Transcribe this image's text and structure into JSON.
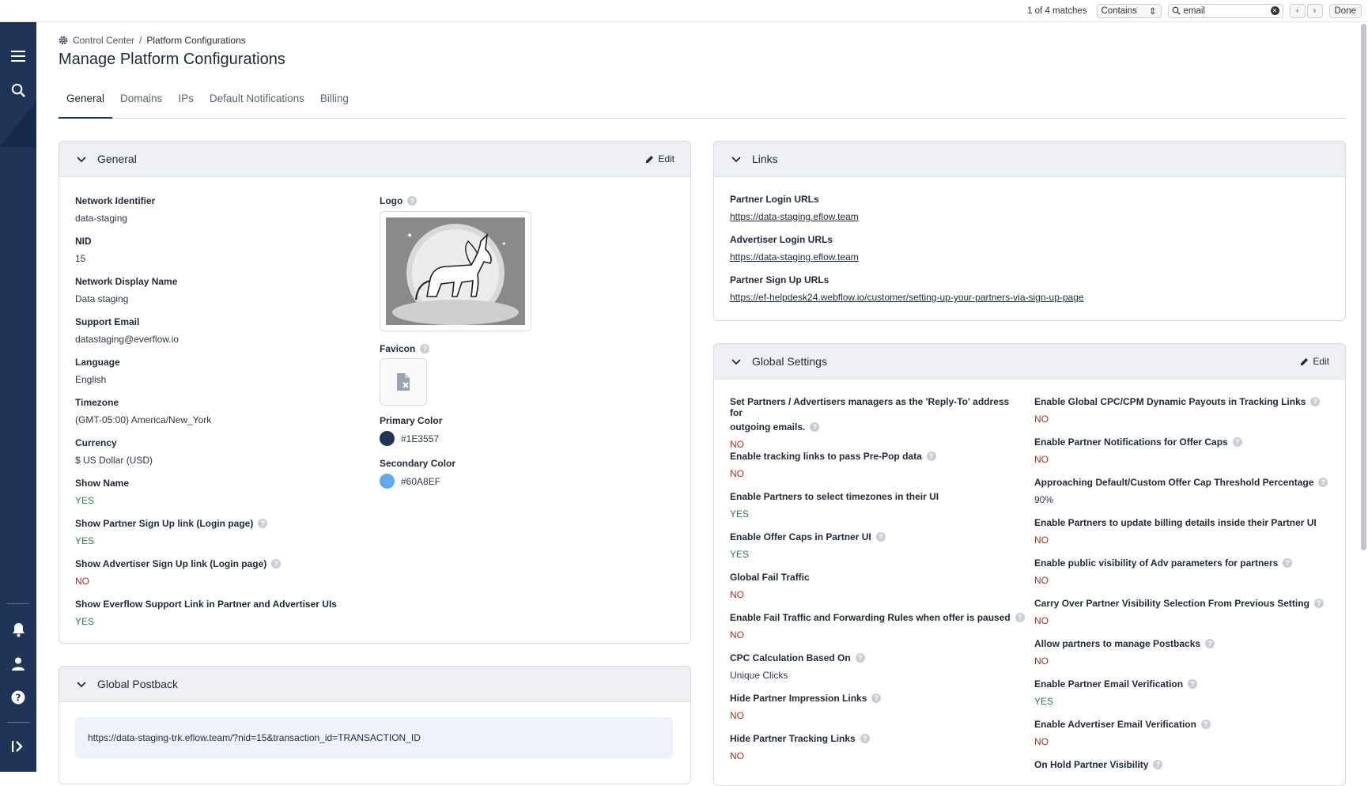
{
  "find_bar": {
    "matches": "1 of 4 matches",
    "mode": "Contains",
    "query": "email",
    "done": "Done"
  },
  "breadcrumb": {
    "root": "Control Center",
    "separator": "/",
    "current": "Platform Configurations"
  },
  "page_title": "Manage Platform Configurations",
  "tabs": [
    "General",
    "Domains",
    "IPs",
    "Default Notifications",
    "Billing"
  ],
  "general": {
    "title": "General",
    "edit": "Edit",
    "fields": [
      {
        "label": "Network Identifier",
        "value": "data-staging"
      },
      {
        "label": "NID",
        "value": "15"
      },
      {
        "label": "Network Display Name",
        "value": "Data staging"
      },
      {
        "label": "Support Email",
        "value": "datastaging@everflow.io"
      },
      {
        "label": "Language",
        "value": "English"
      },
      {
        "label": "Timezone",
        "value": "(GMT-05:00) America/New_York"
      },
      {
        "label": "Currency",
        "value": "$ US Dollar (USD)"
      },
      {
        "label": "Show Name",
        "value": "YES"
      },
      {
        "label": "Show Partner Sign Up link (Login page)",
        "value": "YES"
      },
      {
        "label": "Show Advertiser Sign Up link (Login page)",
        "value": "NO"
      },
      {
        "label": "Show Everflow Support Link in Partner and Advertiser UIs",
        "value": "YES"
      }
    ],
    "logo_label": "Logo",
    "favicon_label": "Favicon",
    "primary_color_label": "Primary Color",
    "primary_color": "#1E3557",
    "secondary_color_label": "Secondary Color",
    "secondary_color": "#60A8EF"
  },
  "links": {
    "title": "Links",
    "fields": [
      {
        "label": "Partner Login URLs",
        "value": "https://data-staging.eflow.team"
      },
      {
        "label": "Advertiser Login URLs",
        "value": "https://data-staging.eflow.team"
      },
      {
        "label": "Partner Sign Up URLs",
        "value": "https://ef-helpdesk24.webflow.io/customer/setting-up-your-partners-via-sign-up-page"
      }
    ]
  },
  "global_settings": {
    "title": "Global Settings",
    "edit": "Edit",
    "left": [
      {
        "label": "Set Partners / Advertisers managers as the 'Reply-To' address for",
        "label2": "outgoing emails.",
        "value": "NO"
      },
      {
        "label": "Enable tracking links to pass Pre-Pop data",
        "value": "NO"
      },
      {
        "label": "Enable Partners to select timezones in their UI",
        "value": "YES"
      },
      {
        "label": "Enable Offer Caps in Partner UI",
        "value": "YES"
      },
      {
        "label": "Global Fail Traffic",
        "value": "NO"
      },
      {
        "label": "Enable Fail Traffic and Forwarding Rules when offer is paused",
        "value": "NO"
      },
      {
        "label": "CPC Calculation Based On",
        "value": "Unique Clicks"
      },
      {
        "label": "Hide Partner Impression Links",
        "value": "NO"
      },
      {
        "label": "Hide Partner Tracking Links",
        "value": "NO"
      }
    ],
    "right": [
      {
        "label": "Enable Global CPC/CPM Dynamic Payouts in Tracking Links",
        "value": "NO"
      },
      {
        "label": "Enable Partner Notifications for Offer Caps",
        "value": "NO"
      },
      {
        "label": "Approaching Default/Custom Offer Cap Threshold Percentage",
        "value": "90%"
      },
      {
        "label": "Enable Partners to update billing details inside their Partner UI",
        "value": "NO"
      },
      {
        "label": "Enable public visibility of Adv parameters for partners",
        "value": "NO"
      },
      {
        "label": "Carry Over Partner Visibility Selection From Previous Setting",
        "value": "NO"
      },
      {
        "label": "Allow partners to manage Postbacks",
        "value": "NO"
      },
      {
        "label": "Enable Partner Email Verification",
        "value": "YES"
      },
      {
        "label": "Enable Advertiser Email Verification",
        "value": "NO"
      },
      {
        "label": "On Hold Partner Visibility",
        "value": ""
      }
    ]
  },
  "global_postback": {
    "title": "Global Postback",
    "url": "https://data-staging-trk.eflow.team/?nid=15&transaction_id=TRANSACTION_ID"
  },
  "icons": {
    "sidebar": [
      "menu-icon",
      "search-icon",
      "bell-icon",
      "user-icon",
      "help-icon",
      "expand-icon"
    ],
    "breadcrumb": "gear-icon"
  },
  "colors": {
    "brand": "#1E3557",
    "yes": "#2F7D4D",
    "no": "#A3342B"
  }
}
